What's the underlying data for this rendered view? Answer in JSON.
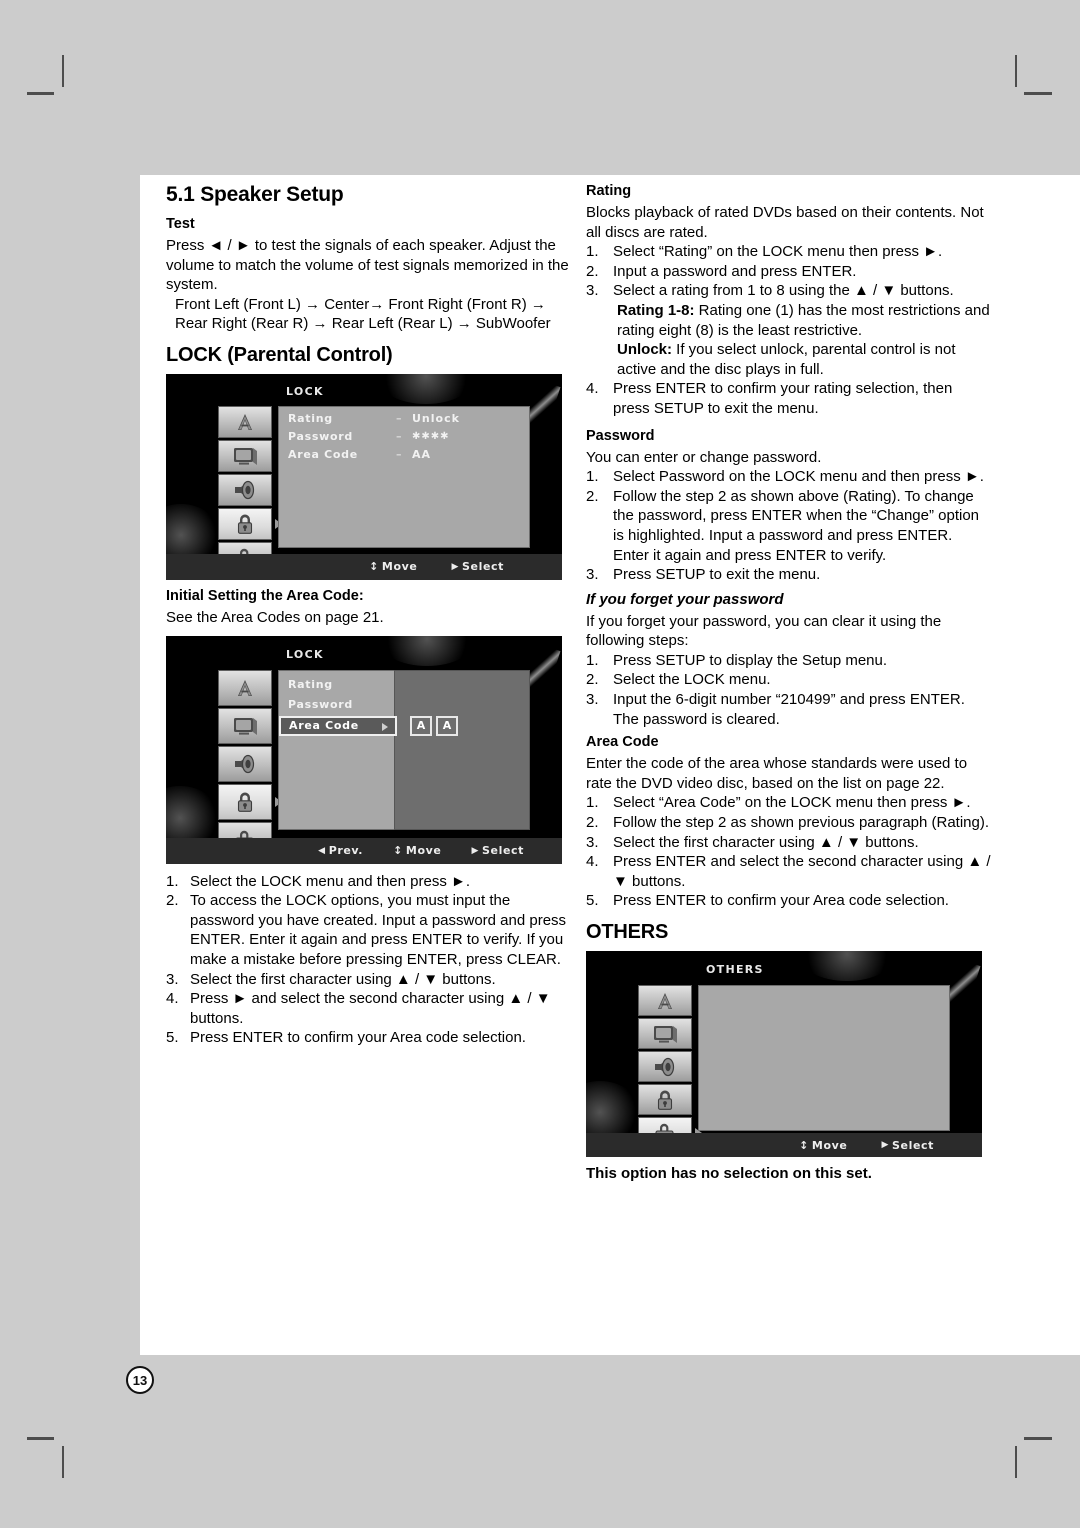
{
  "page": {
    "number": "13"
  },
  "left_column": {
    "heading": "5.1 Speaker Setup",
    "test_heading": "Test",
    "test_p1": "Press ◄ / ► to test the signals of each speaker. Adjust the volume to match the volume of test signals memorized in the system.",
    "test_p2": "Front Left (Front L) → Center→ Front Right (Front R) → Rear Right (Rear R) → Rear Left (Rear L) → SubWoofer",
    "lock_heading": "LOCK (Parental Control)",
    "area_code_heading": "Initial Setting the Area Code:",
    "area_code_note": "See the Area Codes on page 21.",
    "steps": [
      {
        "num": "1.",
        "text": "Select the LOCK menu and then press ►."
      },
      {
        "num": "2.",
        "text": "To access the LOCK options, you must input the password you have created. Input a password and press ENTER. Enter it again and press ENTER to verify. If you make a mistake before pressing ENTER, press CLEAR."
      },
      {
        "num": "3.",
        "text": "Select the first character using ▲ / ▼ buttons."
      },
      {
        "num": "4.",
        "text": "Press ► and select the second character using ▲ / ▼ buttons."
      },
      {
        "num": "5.",
        "text": "Press ENTER to confirm your Area code selection."
      }
    ]
  },
  "right_column": {
    "rating_heading": "Rating",
    "rating_intro": "Blocks playback of rated DVDs based on their contents. Not all discs are rated.",
    "rating_steps": [
      {
        "num": "1.",
        "text": "Select “Rating” on the LOCK menu then press ►."
      },
      {
        "num": "2.",
        "text": "Input a password and press ENTER."
      },
      {
        "num": "3.",
        "text": "Select a rating from 1 to 8 using the ▲ / ▼ buttons."
      },
      {
        "num": "4.",
        "text": "Press ENTER to confirm your rating selection, then press SETUP to exit the menu."
      }
    ],
    "rating_1_8_label": "Rating 1-8:",
    "rating_1_8_text": " Rating one (1) has the most restrictions and rating eight (8) is the least restrictive.",
    "unlock_label": "Unlock:",
    "unlock_text": " If you select unlock, parental control is not active and the disc plays in full.",
    "password_heading": "Password",
    "password_intro": "You can enter or change password.",
    "password_steps": [
      {
        "num": "1.",
        "text": "Select Password on the LOCK menu and then press ►."
      },
      {
        "num": "2.",
        "text": "Follow the step 2 as shown above (Rating). To change the password, press ENTER when the “Change” option is highlighted. Input a password and press ENTER. Enter it again and press ENTER to verify."
      },
      {
        "num": "3.",
        "text": "Press SETUP to exit the menu."
      }
    ],
    "forgot_heading": "If you forget your password",
    "forgot_intro": "If you forget your password, you can clear it using the following steps:",
    "forgot_steps": [
      {
        "num": "1.",
        "text": "Press SETUP to display the Setup menu."
      },
      {
        "num": "2.",
        "text": "Select the LOCK menu."
      },
      {
        "num": "3.",
        "text": "Input the 6-digit number “210499” and press ENTER. The password is cleared."
      }
    ],
    "areacode_heading": "Area Code",
    "areacode_intro": "Enter the code of the area whose standards were used to rate the DVD video disc, based on the list on page 22.",
    "areacode_steps": [
      {
        "num": "1.",
        "text": "Select “Area Code” on the LOCK menu then press ►."
      },
      {
        "num": "2.",
        "text": "Follow the step 2 as shown previous paragraph (Rating)."
      },
      {
        "num": "3.",
        "text": "Select the first character using ▲ / ▼ buttons."
      },
      {
        "num": "4.",
        "text": "Press ENTER and select the second character using ▲ / ▼ buttons."
      },
      {
        "num": "5.",
        "text": "Press ENTER to confirm your Area code selection."
      }
    ],
    "others_heading": "OTHERS",
    "others_note": "This option has no selection on this set."
  },
  "osd_lock": {
    "title": "LOCK",
    "rows": [
      {
        "label": "Rating",
        "sep": "–",
        "value": "Unlock"
      },
      {
        "label": "Password",
        "sep": "–",
        "value": "✱✱✱✱"
      },
      {
        "label": "Area Code",
        "sep": "–",
        "value": "AA"
      }
    ],
    "icons": [
      "language-icon",
      "display-icon",
      "audio-icon",
      "lock-icon",
      "others-icon"
    ],
    "selected_icon": "lock-icon",
    "hints": [
      {
        "glyph": "↕",
        "label": "Move"
      },
      {
        "glyph": "▶",
        "label": "Select"
      }
    ]
  },
  "osd_areacode": {
    "title": "LOCK",
    "rows": [
      {
        "label": "Rating",
        "highlight": false
      },
      {
        "label": "Password",
        "highlight": false
      },
      {
        "label": "Area Code",
        "highlight": true
      }
    ],
    "chips": [
      "A",
      "A"
    ],
    "icons": [
      "language-icon",
      "display-icon",
      "audio-icon",
      "lock-icon",
      "others-icon"
    ],
    "selected_icon": "lock-icon",
    "hints": [
      {
        "glyph": "◀",
        "label": "Prev."
      },
      {
        "glyph": "↕",
        "label": "Move"
      },
      {
        "glyph": "▶",
        "label": "Select"
      }
    ]
  },
  "osd_others": {
    "title": "OTHERS",
    "icons": [
      "language-icon",
      "display-icon",
      "audio-icon",
      "lock-icon",
      "others-icon"
    ],
    "selected_icon": "others-icon",
    "hints": [
      {
        "glyph": "↕",
        "label": "Move"
      },
      {
        "glyph": "▶",
        "label": "Select"
      }
    ]
  },
  "colors": {
    "page_background": "#cccccc",
    "sheet": "#ffffff",
    "osd_background": "#000000",
    "osd_panel": "#a8a8a8",
    "osd_panel_dark": "#6e6e6e",
    "osd_bar": "#2b2b2b",
    "text": "#000000"
  }
}
